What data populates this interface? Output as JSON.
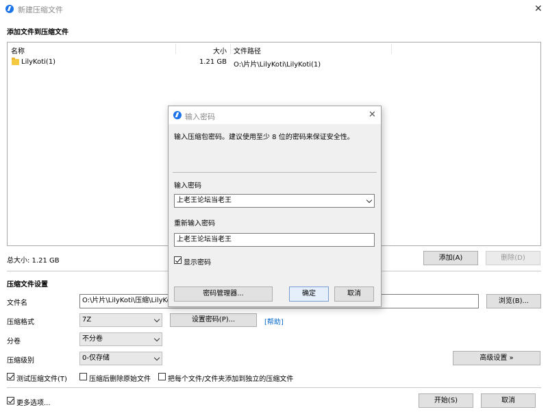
{
  "window": {
    "title": "新建压缩文件",
    "close": "✕"
  },
  "files": {
    "section_title": "添加文件到压缩文件",
    "columns": {
      "name": "名称",
      "size": "大小",
      "path": "文件路径"
    },
    "rows": [
      {
        "name": "LilyKoti(1)",
        "size": "1.21 GB",
        "path": "O:\\片片\\LilyKoti\\LilyKoti(1)"
      }
    ],
    "total": "总大小: 1.21 GB",
    "add_button": "添加(A)",
    "delete_button": "删除(D)"
  },
  "settings": {
    "section_title": "压缩文件设置",
    "filename_label": "文件名",
    "filename_value": "O:\\片片\\LilyKoti\\压缩\\LilyKo",
    "browse_button": "浏览(B)...",
    "format_label": "压缩格式",
    "format_value": "7Z",
    "set_password_button": "设置密码(P)...",
    "help_link": "[帮助]",
    "split_label": "分卷",
    "split_value": "不分卷",
    "level_label": "压缩级别",
    "level_value": "0-仅存储",
    "advanced_button": "高级设置 »",
    "test_label": "测试压缩文件(T)",
    "delete_source_label": "压缩后删除原始文件",
    "separate_label": "把每个文件/文件夹添加到独立的压缩文件",
    "more_options_label": "更多选项...",
    "start_button": "开始(S)",
    "cancel_button": "取消"
  },
  "dialog": {
    "title": "输入密码",
    "close": "✕",
    "description": "输入压缩包密码。建议使用至少 8 位的密码来保证安全性。",
    "password_label": "输入密码",
    "password_value": "上老王论坛当老王",
    "reenter_label": "重新输入密码",
    "reenter_value": "上老王论坛当老王",
    "show_password_label": "显示密码",
    "manager_button": "密码管理器...",
    "ok_button": "确定",
    "cancel_button": "取消"
  }
}
